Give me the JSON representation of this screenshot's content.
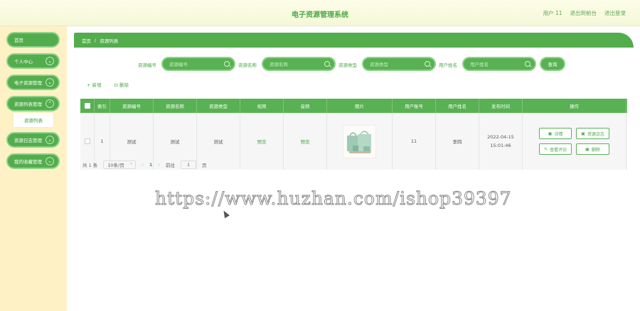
{
  "header": {
    "title": "电子资源管理系统",
    "user": "用户 11",
    "back_link": "退出到前台",
    "logout": "退出登录"
  },
  "sidebar": {
    "items": [
      {
        "label": "首页"
      },
      {
        "label": "个人中心"
      },
      {
        "label": "电子资源管理"
      },
      {
        "label": "资源列表管理"
      },
      {
        "label": "资源日志管理"
      },
      {
        "label": "我的收藏管理"
      }
    ],
    "sub_item": "资源列表"
  },
  "breadcrumb": {
    "home": "首页",
    "sep": "/",
    "current": "资源列表"
  },
  "search": {
    "fields": [
      {
        "label": "资源编号",
        "placeholder": "资源编号"
      },
      {
        "label": "资源名称",
        "placeholder": "资源名称"
      },
      {
        "label": "资源类型",
        "placeholder": "资源类型"
      },
      {
        "label": "用户姓名",
        "placeholder": "用户姓名"
      }
    ],
    "query_label": "查询"
  },
  "toolbar": {
    "add": "+ 新增",
    "delete": "⊡ 删除"
  },
  "table": {
    "headers": [
      "索引",
      "资源编号",
      "资源名称",
      "资源类型",
      "视频",
      "音频",
      "图片",
      "用户账号",
      "用户姓名",
      "发布时间",
      "操作"
    ],
    "rows": [
      {
        "index": "1",
        "code": "测试",
        "name": "测试",
        "type": "测试",
        "video": "预览",
        "audio": "预览",
        "account": "11",
        "username": "李四",
        "time": "2022-04-15 15:01:46",
        "ops": [
          "详情",
          "资源日志",
          "查看评论",
          "删除"
        ]
      }
    ]
  },
  "pager": {
    "total": "共 1 条",
    "size": "10条/页",
    "page": "1",
    "goto_prefix": "前往",
    "goto_value": "1",
    "goto_suffix": "页"
  },
  "watermark": "https://www.huzhan.com/ishop39397",
  "colors": {
    "primary": "#53ad4d",
    "sidebar_bg": "#fdf1c5",
    "header_bg": "#f6f9da"
  }
}
